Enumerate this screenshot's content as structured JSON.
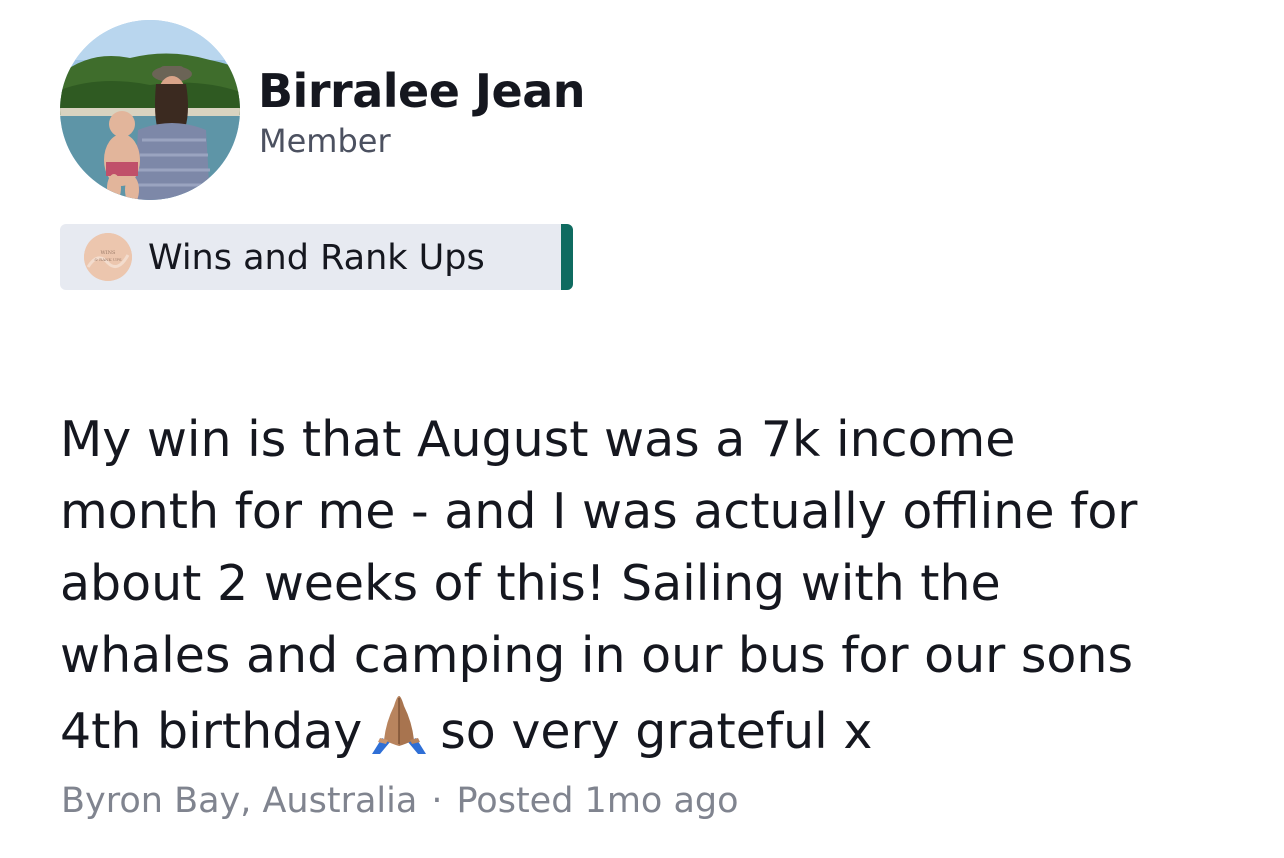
{
  "author": {
    "name": "Birralee Jean",
    "role": "Member"
  },
  "category": {
    "label": "Wins and Rank Ups",
    "icon_text_line1": "WINS",
    "icon_text_line2": "& RANK UPS",
    "accent_color": "#0f6b60"
  },
  "post": {
    "lines": [
      "My win is that August was a 7k income",
      "month for me - and I was actually offline for",
      "about 2 weeks of this! Sailing with the",
      "whales and camping in our bus for our sons",
      "4th birthday"
    ],
    "line5_tail": "so very grateful x",
    "emoji": "folded-hands-icon"
  },
  "meta": {
    "location": "Byron Bay, Australia",
    "separator": "·",
    "posted": "Posted 1mo ago"
  }
}
